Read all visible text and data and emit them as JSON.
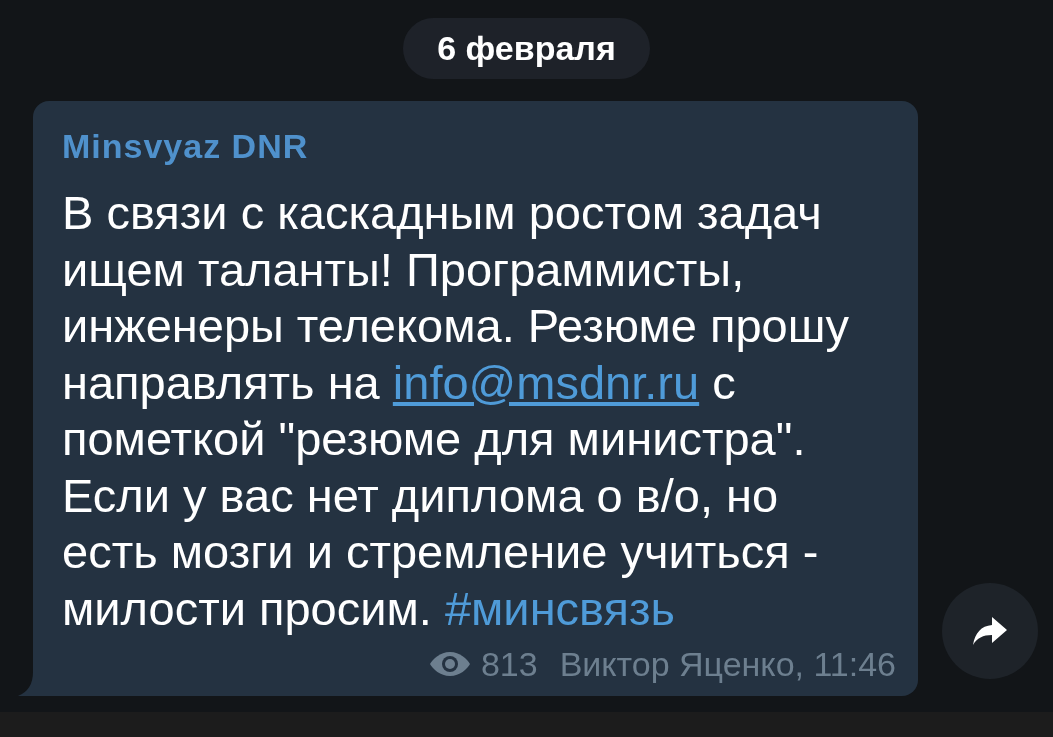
{
  "date_badge": {
    "text": "6 февраля"
  },
  "message": {
    "sender": "Minsvyaz DNR",
    "body": [
      {
        "kind": "plain",
        "text": "В связи с каскадным ростом задач ищем таланты! Программисты, инженеры телекома. Резюме прошу направлять на "
      },
      {
        "kind": "link",
        "text": "info@msdnr.ru"
      },
      {
        "kind": "plain",
        "text": " с пометкой \"резюме для министра\". Если у вас нет диплома о в/о, но есть мозги и стремление учиться - милости просим. "
      },
      {
        "kind": "hashtag",
        "text": "#минсвязь"
      }
    ],
    "views": "813",
    "signature": "Виктор Яценко, 11:46"
  }
}
